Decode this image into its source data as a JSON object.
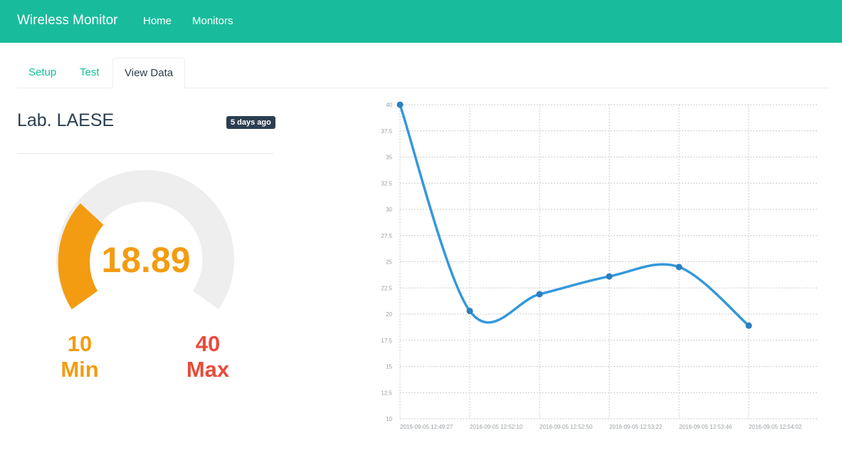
{
  "navbar": {
    "brand": "Wireless Monitor",
    "links": [
      {
        "label": "Home"
      },
      {
        "label": "Monitors"
      }
    ],
    "color": "#18bc9c"
  },
  "tabs": [
    {
      "label": "Setup",
      "active": false
    },
    {
      "label": "Test",
      "active": false
    },
    {
      "label": "View Data",
      "active": true
    }
  ],
  "monitor": {
    "title": "Lab. LAESE",
    "updated_badge": "5 days ago"
  },
  "gauge": {
    "value": "18.89",
    "min": "10",
    "min_label": "Min",
    "max": "40",
    "max_label": "Max",
    "fill_color": "#f39c12",
    "track_color": "#eeeeee",
    "max_color": "#e74c3c"
  },
  "chart_data": {
    "type": "line",
    "title": "",
    "xlabel": "",
    "ylabel": "",
    "x": [
      "2016-09-05 12:49:27",
      "2016-09-05 12:52:10",
      "2016-09-05 12:52:50",
      "2016-09-05 12:53:22",
      "2016-09-05 12:53:46",
      "2016-09-05 12:54:02"
    ],
    "series": [
      {
        "values": [
          40,
          20.3,
          21.9,
          23.6,
          24.5,
          18.9
        ],
        "color": "#3498db"
      }
    ],
    "ylim": [
      10,
      40
    ],
    "yticks": [
      "10",
      "12.5",
      "15",
      "17.5",
      "20",
      "22.5",
      "25",
      "27.5",
      "30",
      "32.5",
      "35",
      "37.5",
      "40"
    ],
    "grid": true,
    "smooth": true
  }
}
